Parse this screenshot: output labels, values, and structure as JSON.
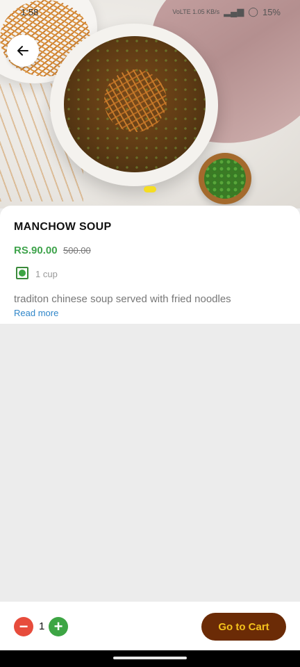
{
  "colors": {
    "price_green": "#3ea34b",
    "minus_red": "#e74c3c",
    "plus_green": "#3da544",
    "cart_bg": "#6b2b06",
    "cart_text": "#f5c21b",
    "page_indicator": "#f5dd23"
  },
  "status_bar": {
    "time": "1:58",
    "network": "VoLTE 1.05 KB/s",
    "battery": "15%"
  },
  "product": {
    "name": "MANCHOW SOUP",
    "price": "RS.90.00",
    "mrp": "500.00",
    "quantity_label": "1 cup",
    "description": "traditon chinese soup served with fried noodles",
    "read_more": "Read more"
  },
  "bottom_bar": {
    "quantity": "1",
    "minus_symbol": "−",
    "plus_symbol": "+",
    "cart_label": "Go to Cart"
  },
  "icons": {
    "back": "arrow-left-icon",
    "veg": "veg-indicator-icon"
  }
}
